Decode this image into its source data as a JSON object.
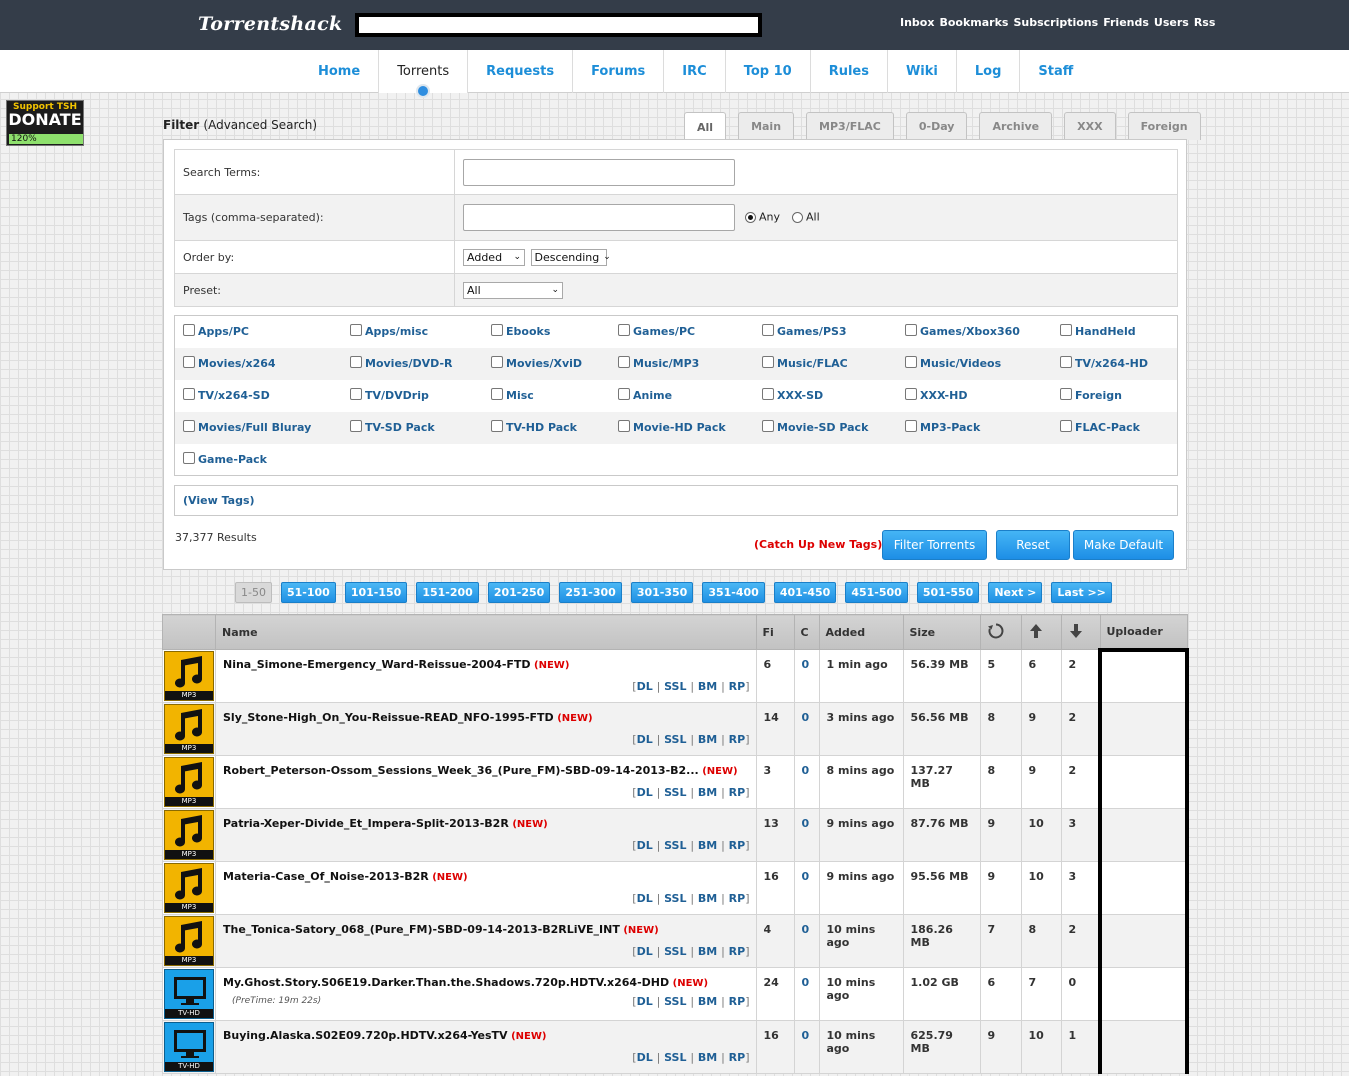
{
  "site": {
    "logo": "Torrentshack"
  },
  "user_links": [
    "Inbox",
    "Bookmarks",
    "Subscriptions",
    "Friends",
    "Users",
    "Rss"
  ],
  "nav": [
    {
      "label": "Home",
      "active": false
    },
    {
      "label": "Torrents",
      "active": true
    },
    {
      "label": "Requests",
      "active": false
    },
    {
      "label": "Forums",
      "active": false
    },
    {
      "label": "IRC",
      "active": false
    },
    {
      "label": "Top 10",
      "active": false
    },
    {
      "label": "Rules",
      "active": false
    },
    {
      "label": "Wiki",
      "active": false
    },
    {
      "label": "Log",
      "active": false
    },
    {
      "label": "Staff",
      "active": false
    }
  ],
  "donate": {
    "line1": "Support TSH",
    "line2": "DONATE",
    "progress": "120%"
  },
  "filter": {
    "title": "Filter",
    "advanced": "(Advanced Search)",
    "tabs": [
      "All",
      "Main",
      "MP3/FLAC",
      "0-Day",
      "Archive",
      "XXX",
      "Foreign"
    ],
    "active_tab": "All",
    "search_terms_label": "Search Terms:",
    "tags_label": "Tags (comma-separated):",
    "any_label": "Any",
    "all_label": "All",
    "order_label": "Order by:",
    "order_by": "Added",
    "order_dir": "Descending",
    "preset_label": "Preset:",
    "preset": "All",
    "view_tags": "(View Tags)",
    "results": "37,377 Results",
    "catchup": "Catch Up New Tags",
    "btn_filter": "Filter Torrents",
    "btn_reset": "Reset",
    "btn_default": "Make Default"
  },
  "categories": [
    [
      "Apps/PC",
      "Apps/misc",
      "Ebooks",
      "Games/PC",
      "Games/PS3",
      "Games/Xbox360",
      "HandHeld"
    ],
    [
      "Movies/x264",
      "Movies/DVD-R",
      "Movies/XviD",
      "Music/MP3",
      "Music/FLAC",
      "Music/Videos",
      "TV/x264-HD"
    ],
    [
      "TV/x264-SD",
      "TV/DVDrip",
      "Misc",
      "Anime",
      "XXX-SD",
      "XXX-HD",
      "Foreign"
    ],
    [
      "Movies/Full Bluray",
      "TV-SD Pack",
      "TV-HD Pack",
      "Movie-HD Pack",
      "Movie-SD Pack",
      "MP3-Pack",
      "FLAC-Pack"
    ],
    [
      "Game-Pack"
    ]
  ],
  "pagination": [
    "1-50",
    "51-100",
    "101-150",
    "151-200",
    "201-250",
    "251-300",
    "301-350",
    "351-400",
    "401-450",
    "451-500",
    "501-550",
    "Next >",
    "Last >>"
  ],
  "table": {
    "headers": {
      "name": "Name",
      "files": "Fi",
      "comments": "C",
      "added": "Added",
      "size": "Size",
      "uploader": "Uploader"
    },
    "link_labels": [
      "DL",
      "SSL",
      "BM",
      "RP"
    ],
    "new_label": "NEW",
    "rows": [
      {
        "cat": "mp3",
        "cat_label": "MP3",
        "name": "Nina_Simone-Emergency_Ward-Reissue-2004-FTD",
        "pretime": "",
        "files": "6",
        "comments": "0",
        "added": "1 min ago",
        "size": "56.39 MB",
        "snatched": "5",
        "seeders": "6",
        "leechers": "2"
      },
      {
        "cat": "mp3",
        "cat_label": "MP3",
        "name": "Sly_Stone-High_On_You-Reissue-READ_NFO-1995-FTD",
        "pretime": "",
        "files": "14",
        "comments": "0",
        "added": "3 mins ago",
        "size": "56.56 MB",
        "snatched": "8",
        "seeders": "9",
        "leechers": "2"
      },
      {
        "cat": "mp3",
        "cat_label": "MP3",
        "name": "Robert_Peterson-Ossom_Sessions_Week_36_(Pure_FM)-SBD-09-14-2013-B2...",
        "pretime": "",
        "files": "3",
        "comments": "0",
        "added": "8 mins ago",
        "size": "137.27 MB",
        "snatched": "8",
        "seeders": "9",
        "leechers": "2"
      },
      {
        "cat": "mp3",
        "cat_label": "MP3",
        "name": "Patria-Xeper-Divide_Et_Impera-Split-2013-B2R",
        "pretime": "",
        "files": "13",
        "comments": "0",
        "added": "9 mins ago",
        "size": "87.76 MB",
        "snatched": "9",
        "seeders": "10",
        "leechers": "3"
      },
      {
        "cat": "mp3",
        "cat_label": "MP3",
        "name": "Materia-Case_Of_Noise-2013-B2R",
        "pretime": "",
        "files": "16",
        "comments": "0",
        "added": "9 mins ago",
        "size": "95.56 MB",
        "snatched": "9",
        "seeders": "10",
        "leechers": "3"
      },
      {
        "cat": "mp3",
        "cat_label": "MP3",
        "name": "The_Tonica-Satory_068_(Pure_FM)-SBD-09-14-2013-B2RLiVE_INT",
        "pretime": "",
        "files": "4",
        "comments": "0",
        "added": "10 mins ago",
        "size": "186.26 MB",
        "snatched": "7",
        "seeders": "8",
        "leechers": "2"
      },
      {
        "cat": "tv",
        "cat_label": "TV-HD",
        "name": "My.Ghost.Story.S06E19.Darker.Than.the.Shadows.720p.HDTV.x264-DHD",
        "pretime": "(PreTime: 19m 22s)",
        "files": "24",
        "comments": "0",
        "added": "10 mins ago",
        "size": "1.02 GB",
        "snatched": "6",
        "seeders": "7",
        "leechers": "0"
      },
      {
        "cat": "tv",
        "cat_label": "TV-HD",
        "name": "Buying.Alaska.S02E09.720p.HDTV.x264-YesTV",
        "pretime": "",
        "files": "16",
        "comments": "0",
        "added": "10 mins ago",
        "size": "625.79 MB",
        "snatched": "9",
        "seeders": "10",
        "leechers": "1"
      }
    ]
  }
}
